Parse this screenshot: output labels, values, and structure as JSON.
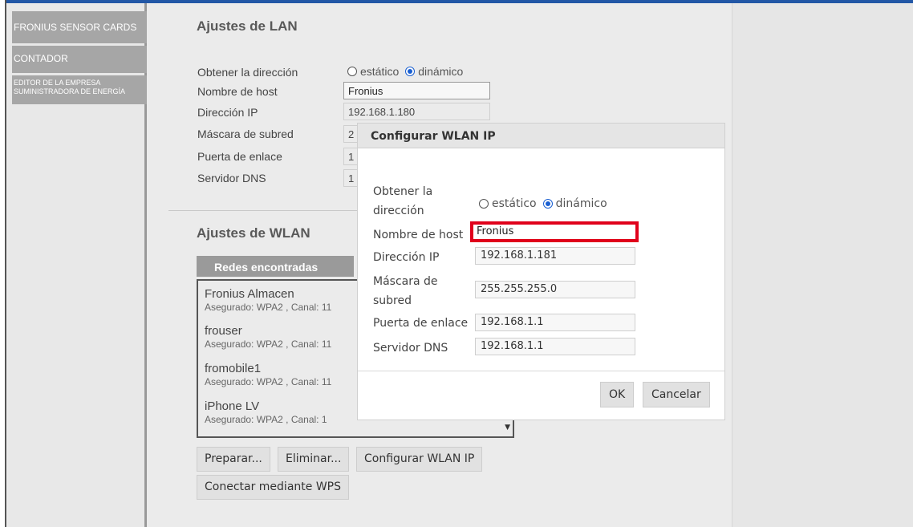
{
  "sidebar": {
    "items": [
      {
        "label": "FRONIUS SENSOR CARDS"
      },
      {
        "label": "CONTADOR"
      },
      {
        "label": "EDITOR DE LA EMPRESA SUMINISTRADORA DE ENERGÍA"
      }
    ]
  },
  "lan": {
    "title": "Ajustes de LAN",
    "address_label": "Obtener la dirección",
    "option_static": "estático",
    "option_dynamic": "dinámico",
    "selected": "dinámico",
    "hostname_label": "Nombre de host",
    "hostname_value": "Fronius",
    "ip_label": "Dirección IP",
    "ip_value": "192.168.1.180",
    "mask_label": "Máscara de subred",
    "mask_value": "2",
    "gateway_label": "Puerta de enlace",
    "gateway_value": "1",
    "dns_label": "Servidor DNS",
    "dns_value": "1"
  },
  "wlan": {
    "title": "Ajustes de WLAN",
    "networks_header": "Redes encontradas",
    "networks": [
      {
        "name": "Fronius Almacen",
        "security": "Asegurado: WPA2 , Canal: 11"
      },
      {
        "name": "frouser",
        "security": "Asegurado: WPA2 , Canal: 11"
      },
      {
        "name": "fromobile1",
        "security": "Asegurado: WPA2 , Canal: 11"
      },
      {
        "name": "iPhone LV",
        "security": "Asegurado: WPA2 , Canal: 1"
      }
    ],
    "buttons": {
      "prepare": "Preparar...",
      "delete": "Eliminar...",
      "configure": "Configurar WLAN IP",
      "wps": "Conectar mediante WPS"
    }
  },
  "dialog": {
    "title": "Configurar WLAN IP",
    "address_label_line1": "Obtener la",
    "address_label_line2": "dirección",
    "option_static": "estático",
    "option_dynamic": "dinámico",
    "selected": "dinámico",
    "hostname_label": "Nombre de host",
    "hostname_value": "Fronius",
    "ip_label": "Dirección IP",
    "ip_value": "192.168.1.181",
    "mask_label_line1": "Máscara de",
    "mask_label_line2": "subred",
    "mask_value": "255.255.255.0",
    "gateway_label": "Puerta de enlace",
    "gateway_value": "192.168.1.1",
    "dns_label": "Servidor DNS",
    "dns_value": "192.168.1.1",
    "ok_label": "OK",
    "cancel_label": "Cancelar"
  },
  "colors": {
    "highlight": "#e0001b",
    "radio_selected": "#1a5fd1",
    "top_bar": "#2257a6"
  }
}
